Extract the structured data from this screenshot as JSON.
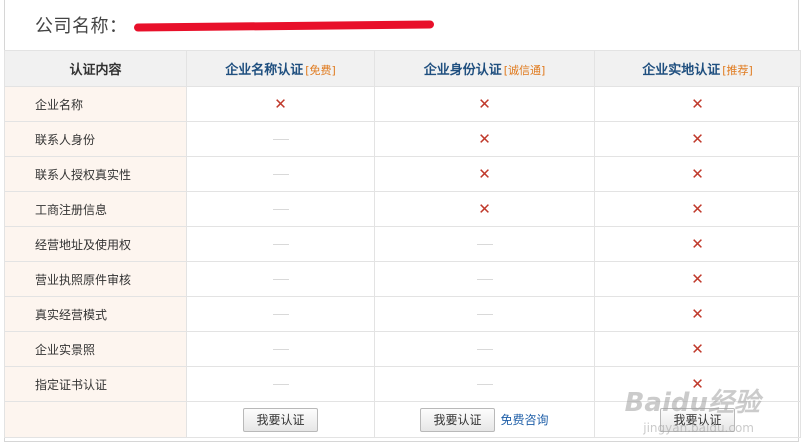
{
  "company": {
    "label": "公司名称："
  },
  "table": {
    "header": {
      "first": "认证内容",
      "columns": [
        {
          "name": "企业名称认证",
          "tag": "[免费]"
        },
        {
          "name": "企业身份认证",
          "tag": "[诚信通]"
        },
        {
          "name": "企业实地认证",
          "tag": "[推荐]"
        }
      ]
    },
    "rows": [
      {
        "label": "企业名称",
        "cells": [
          "cross",
          "cross",
          "cross"
        ]
      },
      {
        "label": "联系人身份",
        "cells": [
          "dash",
          "cross",
          "cross"
        ]
      },
      {
        "label": "联系人授权真实性",
        "cells": [
          "dash",
          "cross",
          "cross"
        ]
      },
      {
        "label": "工商注册信息",
        "cells": [
          "dash",
          "cross",
          "cross"
        ]
      },
      {
        "label": "经营地址及使用权",
        "cells": [
          "dash",
          "dash",
          "cross"
        ]
      },
      {
        "label": "营业执照原件审核",
        "cells": [
          "dash",
          "dash",
          "cross"
        ]
      },
      {
        "label": "真实经营模式",
        "cells": [
          "dash",
          "dash",
          "cross"
        ]
      },
      {
        "label": "企业实景照",
        "cells": [
          "dash",
          "dash",
          "cross"
        ]
      },
      {
        "label": "指定证书认证",
        "cells": [
          "dash",
          "dash",
          "cross"
        ]
      }
    ],
    "actions": {
      "apply_label": "我要认证",
      "consult_label": "免费咨询"
    }
  },
  "watermark": {
    "text": "Baidu经验",
    "sub": "jingyan.baidu.com"
  }
}
